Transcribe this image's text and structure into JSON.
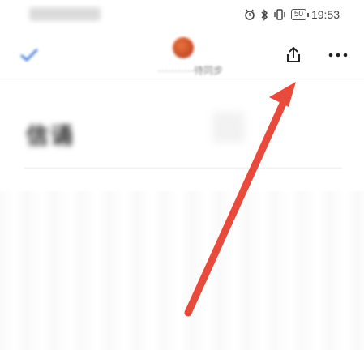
{
  "status_bar": {
    "time": "19:53",
    "battery_level": "50"
  },
  "toolbar": {
    "sync_text": "···········待同步"
  },
  "content": {
    "title": "信诵"
  },
  "colors": {
    "annotation_arrow": "#e84b3c",
    "check_icon": "#4a7fd8",
    "avatar": "#d9512c"
  },
  "icons": {
    "alarm": "alarm-icon",
    "bluetooth": "bluetooth-icon",
    "vibrate": "vibrate-icon",
    "battery": "battery-icon",
    "check": "check-icon",
    "share": "share-icon",
    "more": "more-dots-icon"
  }
}
